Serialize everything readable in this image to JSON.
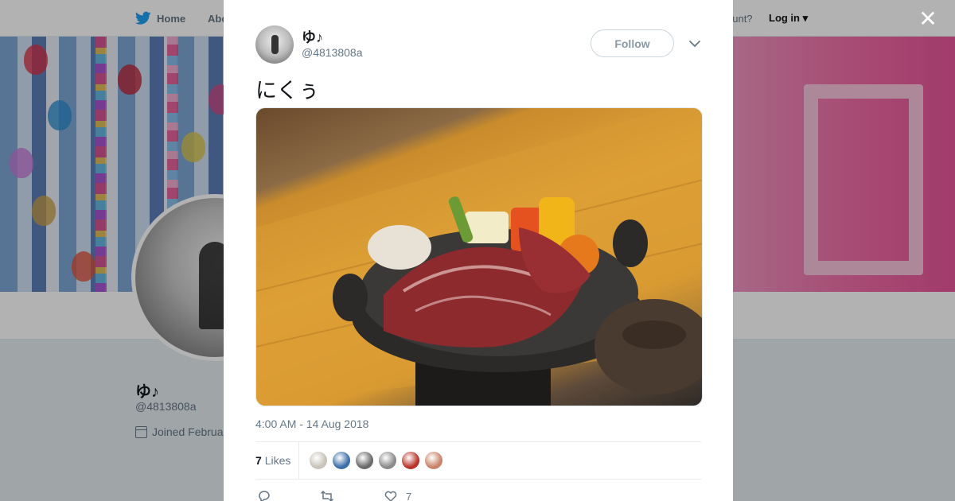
{
  "nav": {
    "home_label": "Home",
    "about_label": "Abo",
    "account_prompt": "ccount?",
    "login_label": "Log in"
  },
  "profile": {
    "name": "ゆ♪",
    "handle": "@4813808a",
    "joined": "Joined Februa"
  },
  "tweet": {
    "author_name": "ゆ♪",
    "author_handle": "@4813808a",
    "follow_label": "Follow",
    "text": "にくぅ",
    "timestamp": "4:00 AM - 14 Aug 2018",
    "likes_count": "7",
    "likes_label": "Likes",
    "like_action_count": "7",
    "liker_colors": [
      "#c8c2b8",
      "#3c6fa8",
      "#6a6a6a",
      "#8a8a8a",
      "#b8342a",
      "#c9836a"
    ]
  },
  "colors": {
    "brand_blue": "#1da1f2",
    "text_primary": "#14171a",
    "text_secondary": "#657786"
  },
  "icons": [
    "bird-logo-icon",
    "calendar-icon",
    "close-icon",
    "chevron-down-icon",
    "reply-icon",
    "retweet-icon",
    "heart-icon"
  ]
}
